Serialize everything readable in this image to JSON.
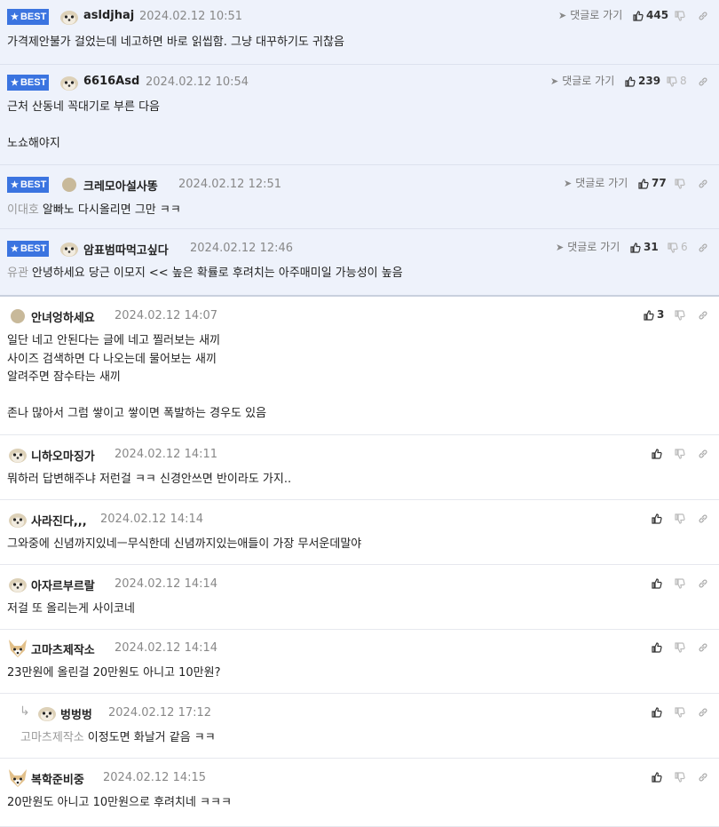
{
  "reply_link_label": "댓글로 가기",
  "best_label": "BEST",
  "colors": {
    "best_badge": "#3b74e0",
    "best_bg": "#eef2fb",
    "divider": "#e6e8ee"
  },
  "comments": [
    {
      "type": "best",
      "nick": "asldjhaj",
      "date": "2024.02.12 10:51",
      "up": "445",
      "down": "",
      "body": "가격제안불가 걸었는데 네고하면 바로 읽씹함. 그냥 대꾸하기도 귀찮음",
      "avatar": "dog-avatar-icon"
    },
    {
      "type": "best",
      "nick": "6616Asd",
      "date": "2024.02.12 10:54",
      "up": "239",
      "down": "8",
      "body": "근처 산동네 꼭대기로 부른 다음\n\n노쇼해야지",
      "avatar": "dog-avatar-icon"
    },
    {
      "type": "best",
      "nick": "크레모아설사똥",
      "date": "2024.02.12 12:51",
      "up": "77",
      "down": "",
      "mention": "이대호",
      "body": "알빠노 다시올리면 그만 ㅋㅋ",
      "avatar": "circle-avatar-icon"
    },
    {
      "type": "best",
      "nick": "암표범따먹고싶다",
      "date": "2024.02.12 12:46",
      "up": "31",
      "down": "6",
      "mention": "유관",
      "body": "안녕하세요 당근 이모지 << 높은 확률로 후려치는 아주매미일 가능성이 높음",
      "avatar": "dog-avatar-icon"
    },
    {
      "type": "normal",
      "nick": "안녀엉하세요",
      "date": "2024.02.12 14:07",
      "up": "3",
      "down": "",
      "body": "일단 네고 안된다는 글에 네고 찔러보는 새끼\n사이즈 검색하면 다 나오는데 물어보는 새끼\n알려주면 잠수타는 새끼\n\n존나 많아서 그럼 쌓이고 쌓이면 폭발하는 경우도 있음",
      "avatar": "circle-avatar-icon"
    },
    {
      "type": "normal",
      "nick": "니하오마징가",
      "date": "2024.02.12 14:11",
      "up": "",
      "down": "",
      "body": "뭐하러 답변해주냐 저런걸 ㅋㅋ 신경안쓰면 반이라도 가지..",
      "avatar": "dog-avatar-icon"
    },
    {
      "type": "normal",
      "nick": "사라진다,,,",
      "date": "2024.02.12 14:14",
      "up": "",
      "down": "",
      "body": "그와중에 신념까지있네ㅡ무식한데 신념까지있는애들이 가장 무서운데말야",
      "avatar": "dog-avatar-icon"
    },
    {
      "type": "normal",
      "nick": "아자르부르랄",
      "date": "2024.02.12 14:14",
      "up": "",
      "down": "",
      "body": "저걸 또 올리는게 사이코네",
      "avatar": "dog-avatar-icon"
    },
    {
      "type": "normal",
      "nick": "고마츠제작소",
      "date": "2024.02.12 14:14",
      "up": "",
      "down": "",
      "body": "23만원에 올린걸 20만원도 아니고 10만원?",
      "avatar": "fox-avatar-icon"
    },
    {
      "type": "reply",
      "nick": "벙벙벙",
      "date": "2024.02.12 17:12",
      "up": "",
      "down": "",
      "mention": "고마츠제작소",
      "body": "이정도면 화날거 같음 ㅋㅋ",
      "avatar": "dog-avatar-icon"
    },
    {
      "type": "normal",
      "nick": "복학준비중",
      "date": "2024.02.12 14:15",
      "up": "",
      "down": "",
      "body": "20만원도 아니고 10만원으로 후려치네 ㅋㅋㅋ",
      "avatar": "fox-avatar-icon"
    }
  ]
}
